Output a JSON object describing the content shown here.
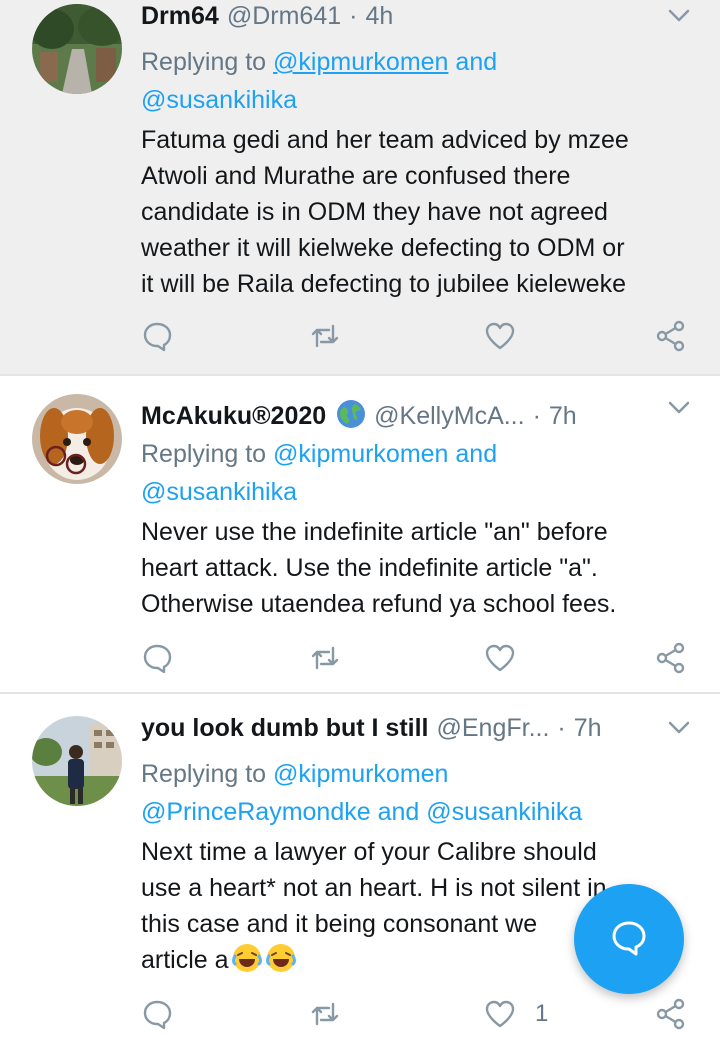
{
  "tweets": [
    {
      "name": "Drm64",
      "handle": "@Drm641",
      "dot": "·",
      "time": "4h",
      "reply_prefix": "Replying to ",
      "reply_link1": "@kipmurkomen",
      "reply_and": " and",
      "reply_link2": "@susankihika",
      "body_lines": [
        "Fatuma gedi and her team adviced by mzee",
        "Atwoli and Murathe are confused there",
        "candidate is in ODM they have not agreed",
        "weather it will kielweke defecting to ODM or",
        "it will be Raila defecting to jubilee kieleweke"
      ]
    },
    {
      "name": "McAkuku®2020",
      "handle": "@KellyMcA...",
      "dot": "·",
      "time": "7h",
      "reply_prefix": "Replying to ",
      "reply_link1": "@kipmurkomen and",
      "reply_link2": "@susankihika",
      "body_lines": [
        "Never use the indefinite article \"an\" before",
        "heart attack. Use the indefinite article \"a\".",
        "Otherwise utaendea refund ya school fees."
      ]
    },
    {
      "name": "you look dumb but I still",
      "handle": "@EngFr...",
      "dot": "·",
      "time": "7h",
      "reply_prefix": "Replying to ",
      "reply_link1": "@kipmurkomen",
      "reply_link2": "@PrinceRaymondke and @susankihika",
      "body_lines": [
        "Next time a lawyer of your Calibre should",
        "use a heart* not an heart. H is not silent in",
        "this case and it being consonant we",
        "article a"
      ],
      "like_count": "1"
    }
  ],
  "colors": {
    "accent": "#1da1f2",
    "muted": "#657786",
    "highlight_bg": "#efefef"
  },
  "icons": [
    "reply-icon",
    "retweet-icon",
    "like-icon",
    "share-icon",
    "chevron-down-icon",
    "globe-emoji-icon",
    "laughing-emoji-icon",
    "compose-reply-icon"
  ]
}
